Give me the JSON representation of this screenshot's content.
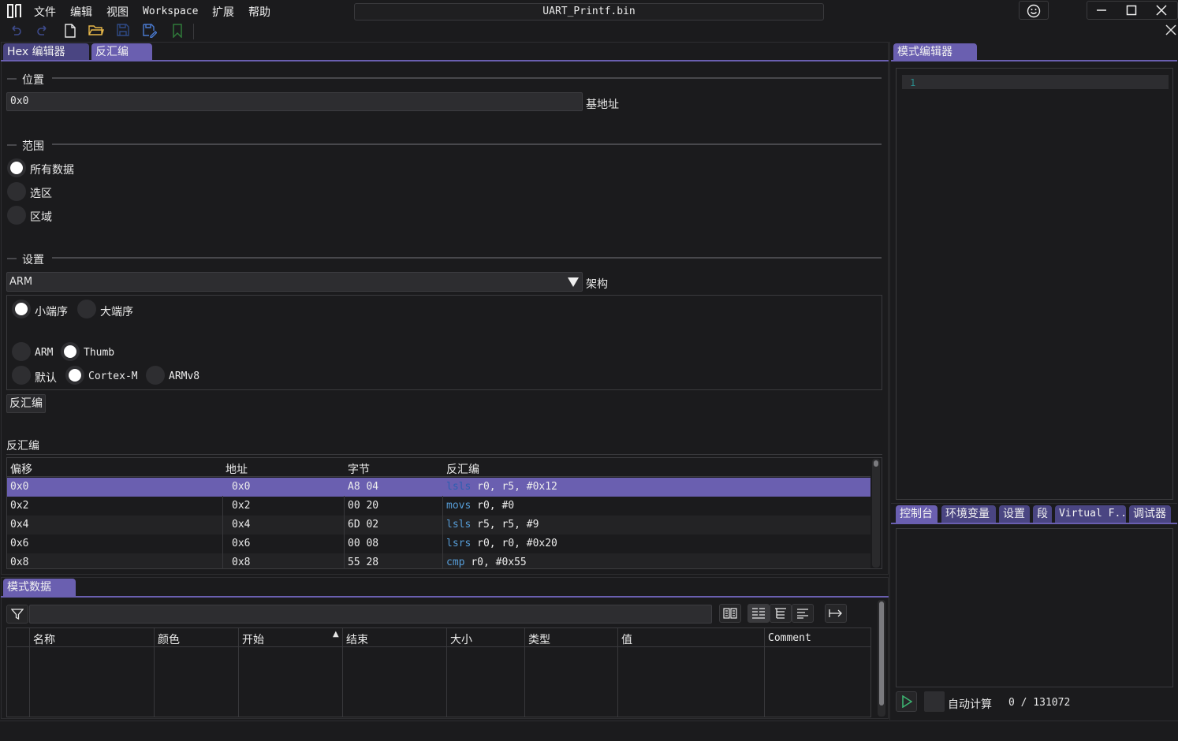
{
  "menu": [
    "文件",
    "编辑",
    "视图",
    "Workspace",
    "扩展",
    "帮助"
  ],
  "window_title": "UART_Printf.bin",
  "main_tabs": [
    "Hex 编辑器",
    "反汇编"
  ],
  "right_tab": "模式编辑器",
  "position": {
    "section": "位置",
    "value": "0x0",
    "label": "基地址"
  },
  "range": {
    "section": "范围",
    "options": [
      "所有数据",
      "选区",
      "区域"
    ],
    "selected": "所有数据"
  },
  "settings": {
    "section": "设置",
    "arch_value": "ARM",
    "arch_label": "架构",
    "endian": [
      "小端序",
      "大端序"
    ],
    "endian_selected": "小端序",
    "mode": [
      "ARM",
      "Thumb"
    ],
    "mode_selected": "Thumb",
    "cpu": [
      "默认",
      "Cortex-M",
      "ARMv8"
    ],
    "cpu_selected": "Cortex-M"
  },
  "disassemble_button": "反汇编",
  "disasm_section": "反汇编",
  "disasm_table": {
    "headers": [
      "偏移",
      "地址",
      "字节",
      "反汇编"
    ],
    "rows": [
      {
        "offset": "0x0",
        "address": "0x0",
        "bytes": "A8 04",
        "mnemonic": "lsls",
        "operands": "r0, r5, #0x12"
      },
      {
        "offset": "0x2",
        "address": "0x2",
        "bytes": "00 20",
        "mnemonic": "movs",
        "operands": "r0, #0"
      },
      {
        "offset": "0x4",
        "address": "0x4",
        "bytes": "6D 02",
        "mnemonic": "lsls",
        "operands": "r5, r5, #9"
      },
      {
        "offset": "0x6",
        "address": "0x6",
        "bytes": "00 08",
        "mnemonic": "lsrs",
        "operands": "r0, r0, #0x20"
      },
      {
        "offset": "0x8",
        "address": "0x8",
        "bytes": "55 28",
        "mnemonic": "cmp",
        "operands": "r0, #0x55"
      }
    ]
  },
  "pattern_data_tab": "模式数据",
  "pattern_table": {
    "headers": [
      "名称",
      "颜色",
      "开始",
      "结束",
      "大小",
      "类型",
      "值",
      "Comment"
    ]
  },
  "editor": {
    "line_number": "1"
  },
  "bottom_tabs": [
    "控制台",
    "环境变量",
    "设置",
    "段",
    "Virtual F...",
    "调试器"
  ],
  "footer": {
    "auto_label": "自动计算",
    "progress": "0 / 131072"
  },
  "colors": {
    "accent": "#6a5fb0",
    "background": "#1b1b1d",
    "mnemonic": "#569cd6",
    "run_icon": "#3cb371"
  }
}
